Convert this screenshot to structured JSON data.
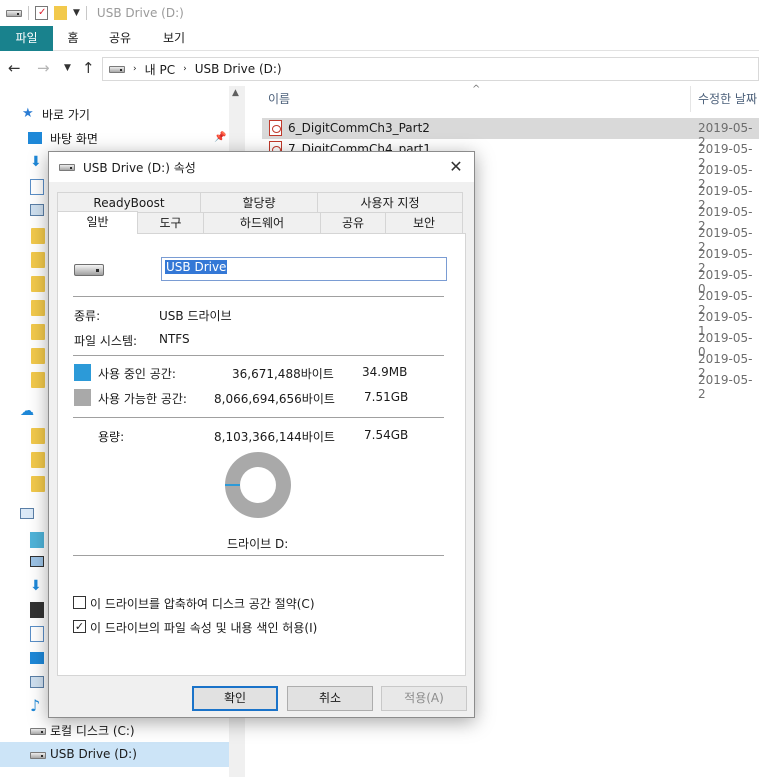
{
  "window": {
    "title": "USB Drive (D:)"
  },
  "ribbon": {
    "tabs": [
      "파일",
      "홈",
      "공유",
      "보기"
    ]
  },
  "address": {
    "crumbs": [
      "내 PC",
      "USB Drive (D:)"
    ]
  },
  "nav": {
    "quick_access": "바로 가기",
    "desktop": "바탕 화면",
    "local_disk": "로컬 디스크 (C:)",
    "usb": "USB Drive (D:)"
  },
  "files": {
    "col_name": "이름",
    "col_date": "수정한 날짜",
    "rows": [
      {
        "name": "6_DigitCommCh3_Part2",
        "date": "2019-05-2"
      },
      {
        "name": "7_DigitCommCh4_part1",
        "date": "2019-05-2"
      },
      {
        "name": "",
        "date": "2019-05-2"
      },
      {
        "name": "",
        "date": "2019-05-2"
      },
      {
        "name": "",
        "date": "2019-05-2"
      },
      {
        "name": "",
        "date": "2019-05-2"
      },
      {
        "name": "",
        "date": "2019-05-2"
      },
      {
        "name": "",
        "date": "2019-05-0"
      },
      {
        "name": "",
        "date": "2019-05-2"
      },
      {
        "name": "",
        "date": "2019-05-1"
      },
      {
        "name": "",
        "date": "2019-05-0"
      },
      {
        "name": "",
        "date": "2019-05-2"
      },
      {
        "name": "",
        "date": "2019-05-2"
      }
    ]
  },
  "dialog": {
    "title": "USB Drive (D:) 속성",
    "tabs_back": [
      "ReadyBoost",
      "할당량",
      "사용자 지정"
    ],
    "tabs_front": [
      "일반",
      "도구",
      "하드웨어",
      "공유",
      "보안"
    ],
    "drive_name": "USB Drive",
    "type_label": "종류:",
    "type_value": "USB 드라이브",
    "fs_label": "파일 시스템:",
    "fs_value": "NTFS",
    "used_label": "사용 중인 공간:",
    "used_bytes": "36,671,488바이트",
    "used_size": "34.9MB",
    "free_label": "사용 가능한 공간:",
    "free_bytes": "8,066,694,656바이트",
    "free_size": "7.51GB",
    "cap_label": "용량:",
    "cap_bytes": "8,103,366,144바이트",
    "cap_size": "7.54GB",
    "drive_label": "드라이브 D:",
    "compress_label": "이 드라이브를 압축하여 디스크 공간 절약(C)",
    "compress_checked": false,
    "index_label": "이 드라이브의 파일 속성 및 내용 색인 허용(I)",
    "index_checked": true,
    "used_fraction": 0.0045,
    "buttons": {
      "ok": "확인",
      "cancel": "취소",
      "apply": "적용(A)"
    },
    "colors": {
      "used": "#2c9ad8",
      "free": "#a9a9a9"
    }
  }
}
